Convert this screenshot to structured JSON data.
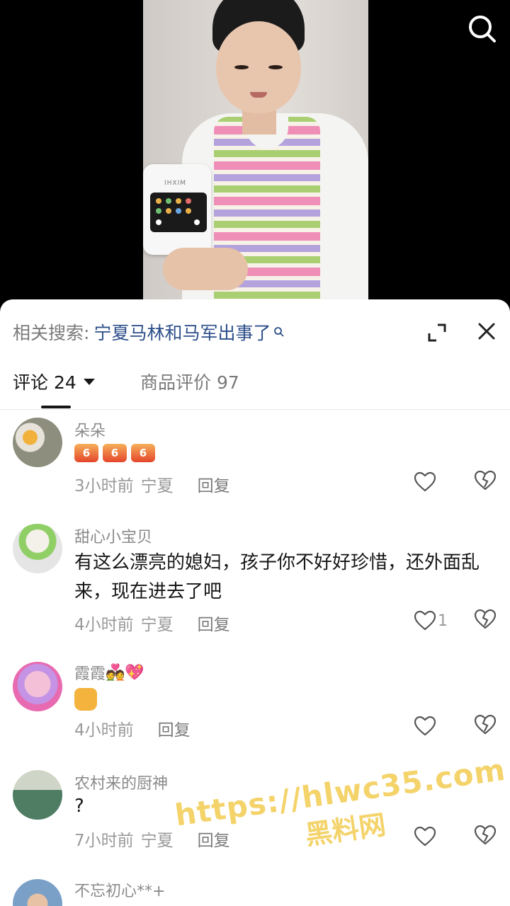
{
  "related_search": {
    "label": "相关搜索:",
    "query": "宁夏马林和马军出事了"
  },
  "tabs": {
    "comments": "评论 24",
    "reviews": "商品评价 97"
  },
  "appliance_brand": "IHXIM",
  "comments": [
    {
      "name": "朵朵",
      "emoji_label": "6",
      "time": "3小时前",
      "location": "宁夏",
      "reply": "回复",
      "likes": ""
    },
    {
      "name": "甜心小宝贝",
      "text": "有这么漂亮的媳妇，孩子你不好好珍惜，还外面乱来，现在进去了吧",
      "time": "4小时前",
      "location": "宁夏",
      "reply": "回复",
      "likes": "1"
    },
    {
      "name": "霞霞",
      "time": "4小时前",
      "reply": "回复",
      "likes": ""
    },
    {
      "name": "农村来的厨神",
      "text": "?",
      "time": "7小时前",
      "location": "宁夏",
      "reply": "回复",
      "likes": ""
    },
    {
      "name": "不忘初心**+"
    }
  ],
  "watermark": {
    "url": "https://hlwc35.com",
    "name": "黑料网"
  },
  "colors": {
    "link_blue": "#2d4f8a",
    "muted": "#8a8a8a",
    "watermark": "#f4d36a"
  }
}
